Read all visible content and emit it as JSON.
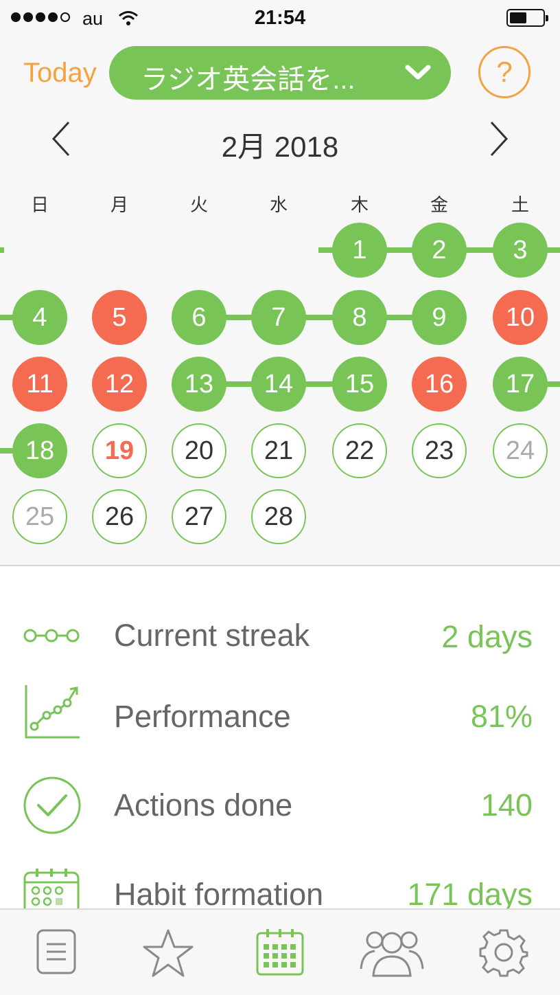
{
  "status_bar": {
    "carrier": "au",
    "time": "21:54",
    "signal_bars": 4,
    "signal_max": 5
  },
  "header": {
    "today_label": "Today",
    "habit_title": "ラジオ英会話を...",
    "help_label": "?"
  },
  "calendar": {
    "month_label": "2月 2018",
    "weekdays": [
      "日",
      "月",
      "火",
      "水",
      "木",
      "金",
      "土"
    ],
    "days": [
      {
        "n": "1",
        "s": "done"
      },
      {
        "n": "2",
        "s": "done"
      },
      {
        "n": "3",
        "s": "done"
      },
      {
        "n": "4",
        "s": "done"
      },
      {
        "n": "5",
        "s": "missed"
      },
      {
        "n": "6",
        "s": "done"
      },
      {
        "n": "7",
        "s": "done"
      },
      {
        "n": "8",
        "s": "done"
      },
      {
        "n": "9",
        "s": "done"
      },
      {
        "n": "10",
        "s": "missed"
      },
      {
        "n": "11",
        "s": "missed"
      },
      {
        "n": "12",
        "s": "missed"
      },
      {
        "n": "13",
        "s": "done"
      },
      {
        "n": "14",
        "s": "done"
      },
      {
        "n": "15",
        "s": "done"
      },
      {
        "n": "16",
        "s": "missed"
      },
      {
        "n": "17",
        "s": "done"
      },
      {
        "n": "18",
        "s": "done"
      },
      {
        "n": "19",
        "s": "today"
      },
      {
        "n": "20",
        "s": "future"
      },
      {
        "n": "21",
        "s": "future"
      },
      {
        "n": "22",
        "s": "future"
      },
      {
        "n": "23",
        "s": "future"
      },
      {
        "n": "24",
        "s": "future"
      },
      {
        "n": "25",
        "s": "future"
      },
      {
        "n": "26",
        "s": "future"
      },
      {
        "n": "27",
        "s": "future"
      },
      {
        "n": "28",
        "s": "future"
      }
    ],
    "first_weekday": 4,
    "colors": {
      "done": "#78c456",
      "missed": "#f46b51",
      "accent": "#f4a340"
    }
  },
  "stats": [
    {
      "icon": "streak-icon",
      "label": "Current streak",
      "value": "2 days"
    },
    {
      "icon": "performance-chart-icon",
      "label": "Performance",
      "value": "81%"
    },
    {
      "icon": "checkmark-circle-icon",
      "label": "Actions done",
      "value": "140"
    },
    {
      "icon": "calendar-grid-icon",
      "label": "Habit formation",
      "value": "171 days"
    }
  ],
  "tab_bar": {
    "tabs": [
      {
        "icon": "list-icon",
        "active": false
      },
      {
        "icon": "star-icon",
        "active": false
      },
      {
        "icon": "calendar-icon",
        "active": true
      },
      {
        "icon": "community-icon",
        "active": false
      },
      {
        "icon": "settings-gear-icon",
        "active": false
      }
    ]
  }
}
